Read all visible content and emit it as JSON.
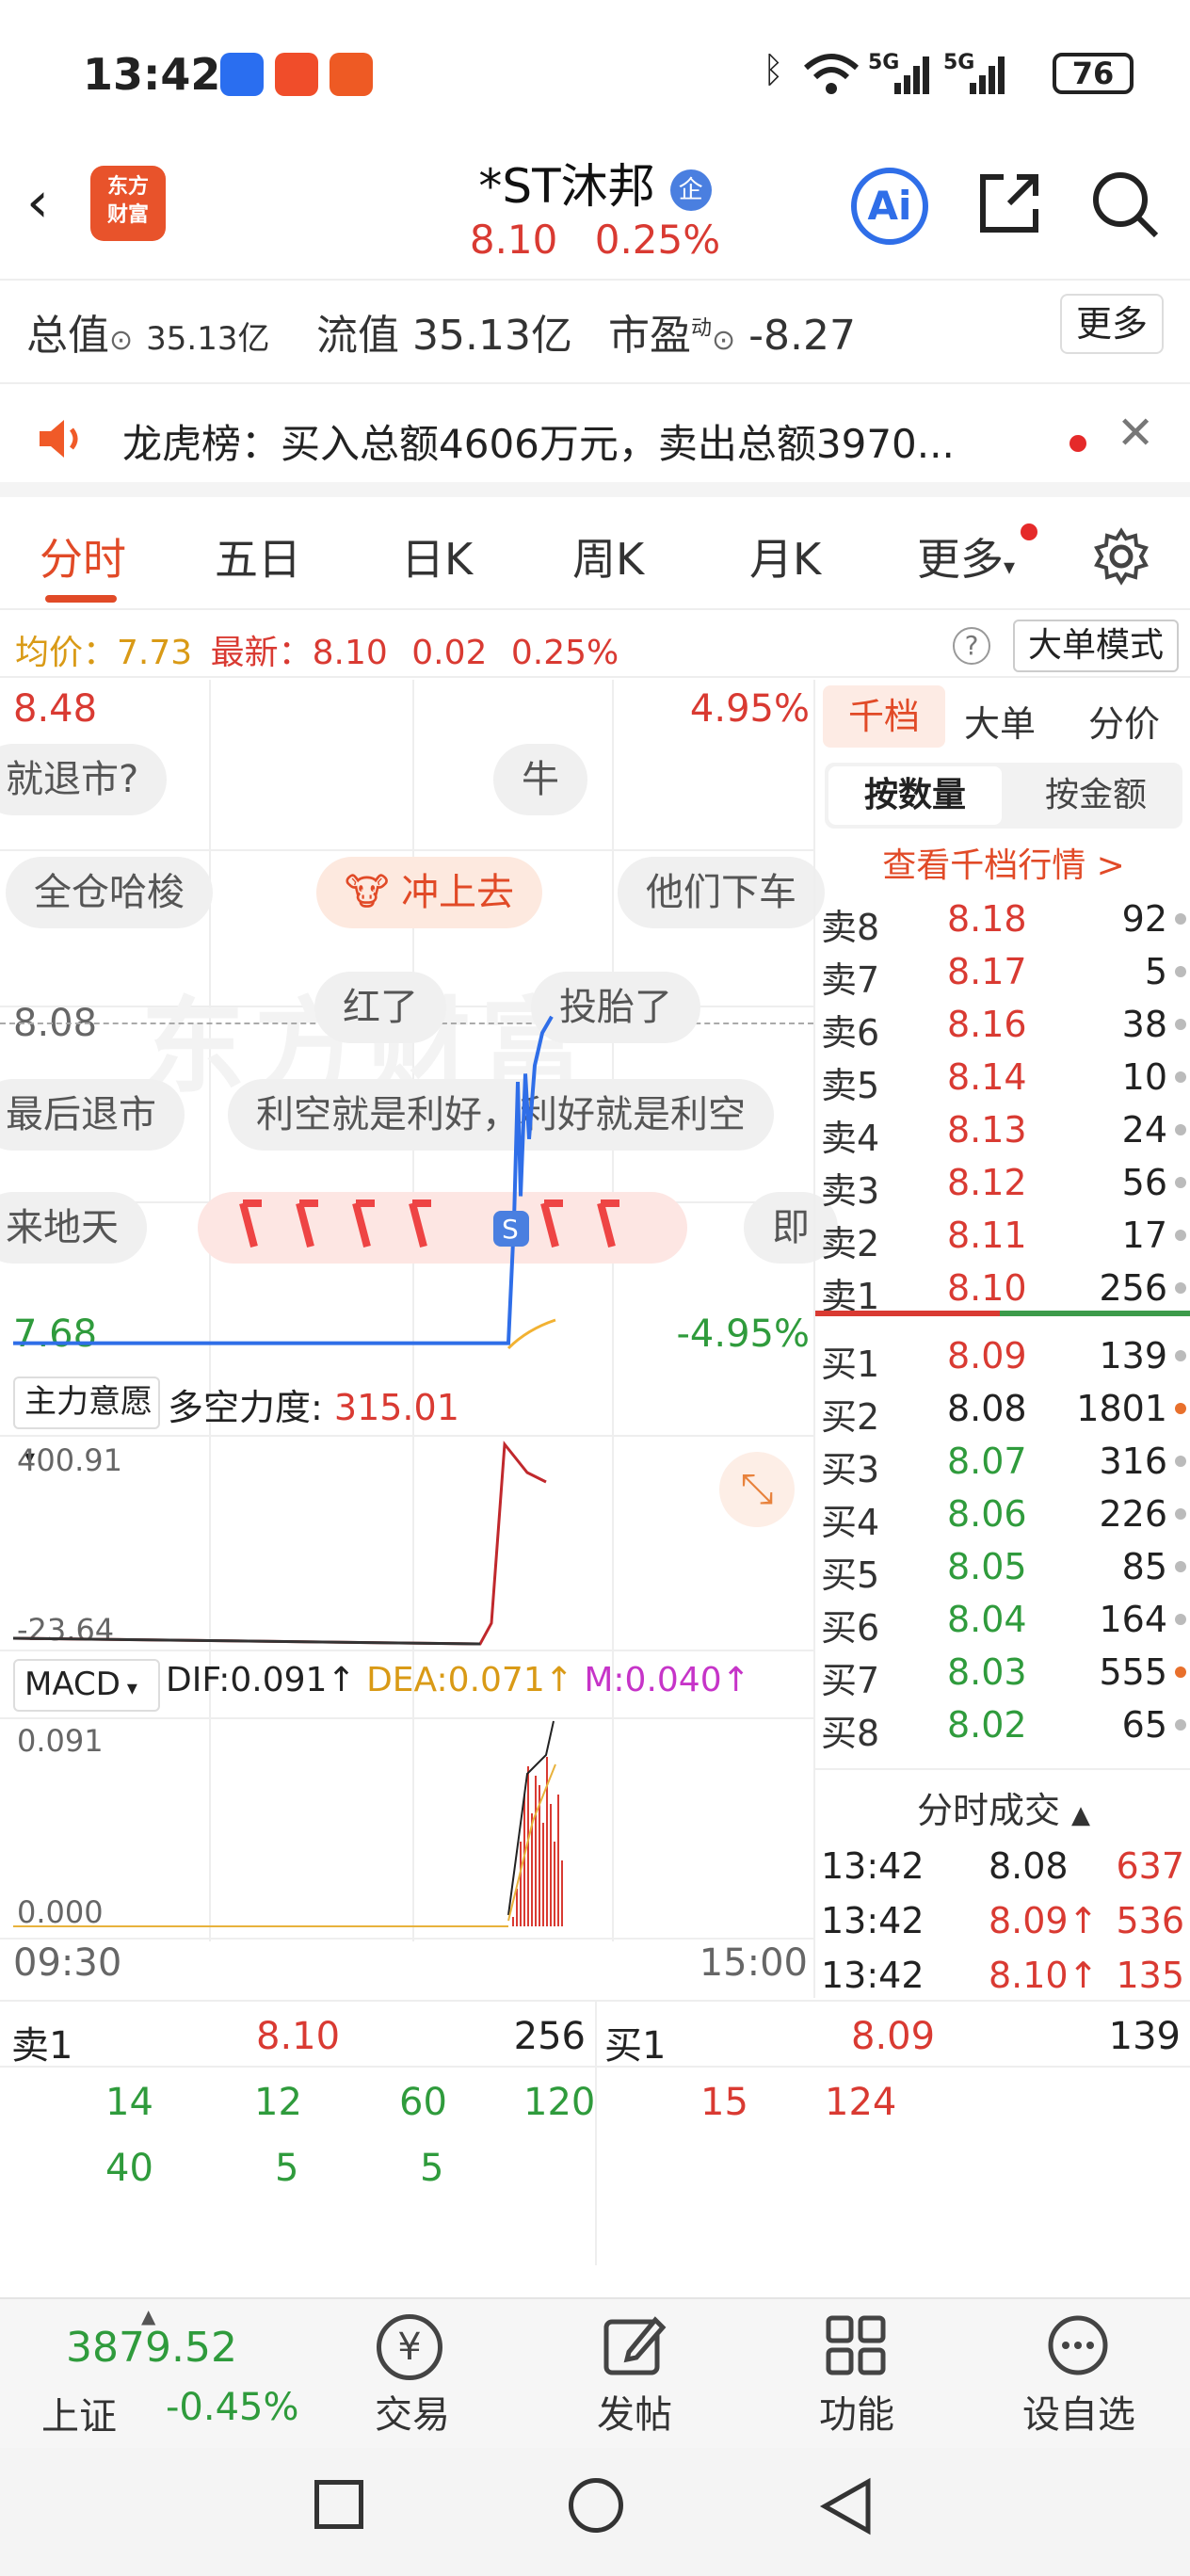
{
  "status": {
    "time": "13:42",
    "battery": "76",
    "signal1": "5G",
    "signal2": "5G"
  },
  "header": {
    "back_icon": "chevron-left-icon",
    "logo_line1": "东方",
    "logo_line2": "财富",
    "title": "*ST沐邦",
    "badge": "企",
    "price": "8.10",
    "change_pct": "0.25%",
    "ai_label": "Ai"
  },
  "metrics": {
    "total_label": "总值",
    "total_value": "35.13亿",
    "float_label": "流值",
    "float_value": "35.13亿",
    "pe_label": "市盈",
    "pe_super": "动",
    "pe_value": "-8.27",
    "more_label": "更多"
  },
  "notice": {
    "text": "龙虎榜：买入总额4606万元，卖出总额3970..."
  },
  "tabs": {
    "items": [
      "分时",
      "五日",
      "日K",
      "周K",
      "月K",
      "更多"
    ]
  },
  "infoline": {
    "avg_label": "均价：",
    "avg_value": "7.73",
    "latest_label": "最新：",
    "latest_value": "8.10",
    "change": "0.02",
    "change_pct": "0.25%",
    "mode_label": "大单模式"
  },
  "chart": {
    "high_price": "8.48",
    "high_pct": "4.95%",
    "low_price": "7.68",
    "low_pct": "-4.95%",
    "ref_price": "8.08",
    "watermark": "东方财富",
    "bubbles": [
      "就退市?",
      "牛",
      "全仓哈梭",
      "冲上去",
      "他们下车",
      "红了",
      "投胎了",
      "最后退市",
      "利空就是利好，利好就是利空",
      "来地天",
      "即"
    ],
    "indicator1_name": "主力意愿",
    "indicator1_label": "多空力度:",
    "indicator1_value": "315.01",
    "ind1_top": "400.91",
    "ind1_bottom": "-23.64",
    "macd_name": "MACD",
    "dif": "DIF:0.091",
    "dea": "DEA:0.071",
    "m": "M:0.040",
    "macd_top": "0.091",
    "macd_bottom": "0.000",
    "time_start": "09:30",
    "time_end": "15:00"
  },
  "chart_data": {
    "type": "line",
    "x": [
      "09:30",
      "13:40",
      "13:41",
      "13:42"
    ],
    "series": [
      {
        "values": [
          7.7,
          7.7,
          8.03,
          8.1
        ]
      }
    ],
    "ylim": [
      7.68,
      8.48
    ]
  },
  "book": {
    "tabs": [
      "千档",
      "大单",
      "分价"
    ],
    "seg_on": "按数量",
    "seg_off": "按金额",
    "view_link": "查看千档行情 >",
    "asks": [
      {
        "label": "卖8",
        "price": "8.18",
        "vol": "92"
      },
      {
        "label": "卖7",
        "price": "8.17",
        "vol": "5"
      },
      {
        "label": "卖6",
        "price": "8.16",
        "vol": "38"
      },
      {
        "label": "卖5",
        "price": "8.14",
        "vol": "10"
      },
      {
        "label": "卖4",
        "price": "8.13",
        "vol": "24"
      },
      {
        "label": "卖3",
        "price": "8.12",
        "vol": "56"
      },
      {
        "label": "卖2",
        "price": "8.11",
        "vol": "17"
      },
      {
        "label": "卖1",
        "price": "8.10",
        "vol": "256"
      }
    ],
    "bids": [
      {
        "label": "买1",
        "price": "8.09",
        "vol": "139"
      },
      {
        "label": "买2",
        "price": "8.08",
        "vol": "1801"
      },
      {
        "label": "买3",
        "price": "8.07",
        "vol": "316"
      },
      {
        "label": "买4",
        "price": "8.06",
        "vol": "226"
      },
      {
        "label": "买5",
        "price": "8.05",
        "vol": "85"
      },
      {
        "label": "买6",
        "price": "8.04",
        "vol": "164"
      },
      {
        "label": "买7",
        "price": "8.03",
        "vol": "555"
      },
      {
        "label": "买8",
        "price": "8.02",
        "vol": "65"
      }
    ],
    "trades_title": "分时成交",
    "trades": [
      {
        "time": "13:42",
        "price": "8.08",
        "vol": "637"
      },
      {
        "time": "13:42",
        "price": "8.09↑",
        "vol": "536"
      },
      {
        "time": "13:42",
        "price": "8.10↑",
        "vol": "135"
      }
    ]
  },
  "quote": {
    "sell_label": "卖1",
    "sell_price": "8.10",
    "sell_vol": "256",
    "buy_label": "买1",
    "buy_price": "8.09",
    "buy_vol": "139",
    "sell_row1": [
      "14",
      "12",
      "60",
      "120"
    ],
    "sell_row2": [
      "40",
      "5",
      "5"
    ],
    "buy_row1": [
      "15",
      "124"
    ]
  },
  "nav": {
    "index_value": "3879.52",
    "index_name": "上证",
    "index_change": "-0.45%",
    "items": [
      "交易",
      "发帖",
      "功能",
      "设自选"
    ],
    "trade_icon_text": "¥"
  },
  "colors": {
    "accent": "#e14a27",
    "up": "#d93a32",
    "down": "#2f9b3c",
    "line": "#2f6ee8"
  }
}
